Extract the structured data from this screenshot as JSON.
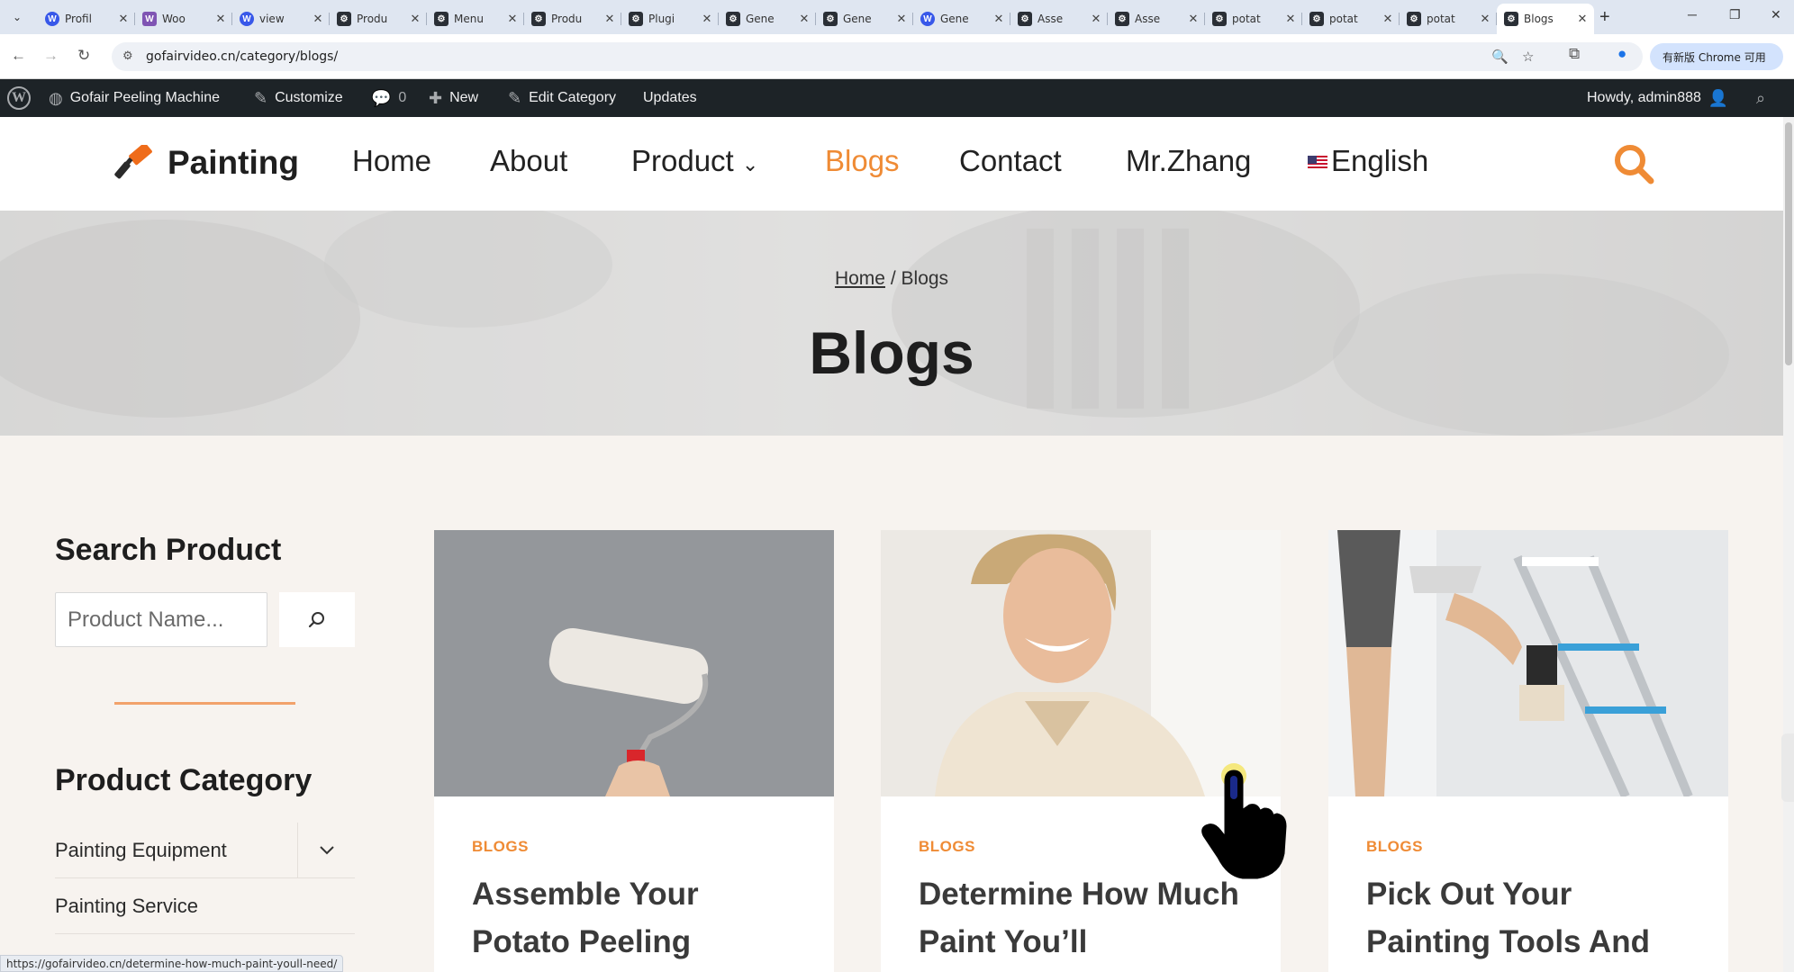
{
  "browser": {
    "tabs": [
      {
        "title": "Profil",
        "icon": "wordpress-icon"
      },
      {
        "title": "Woo",
        "icon": "woo-icon"
      },
      {
        "title": "view",
        "icon": "wordpress-icon"
      },
      {
        "title": "Produ",
        "icon": "gear-icon"
      },
      {
        "title": "Menu",
        "icon": "gear-icon"
      },
      {
        "title": "Produ",
        "icon": "gear-icon"
      },
      {
        "title": "Plugi",
        "icon": "gear-icon"
      },
      {
        "title": "Gene",
        "icon": "gear-icon"
      },
      {
        "title": "Gene",
        "icon": "gear-icon"
      },
      {
        "title": "Gene",
        "icon": "wordpress-icon"
      },
      {
        "title": "Asse",
        "icon": "gear-icon"
      },
      {
        "title": "Asse",
        "icon": "gear-icon"
      },
      {
        "title": "potat",
        "icon": "gear-icon"
      },
      {
        "title": "potat",
        "icon": "gear-icon"
      },
      {
        "title": "potat",
        "icon": "gear-icon"
      },
      {
        "title": "Blogs",
        "icon": "gear-icon",
        "active": true
      }
    ],
    "url": "gofairvideo.cn/category/blogs/",
    "chrome_badge": "有新版 Chrome 可用"
  },
  "adminbar": {
    "site_name": "Gofair Peeling Machine",
    "customize": "Customize",
    "comments_count": "0",
    "new": "New",
    "edit_category": "Edit Category",
    "updates": "Updates",
    "howdy": "Howdy, admin888"
  },
  "header": {
    "logo_text": "Painting",
    "nav": [
      {
        "label": "Home",
        "active": false
      },
      {
        "label": "About",
        "active": false
      },
      {
        "label": "Product",
        "active": false,
        "has_dropdown": true
      },
      {
        "label": "Blogs",
        "active": true
      },
      {
        "label": "Contact",
        "active": false
      },
      {
        "label": "Mr.Zhang",
        "active": false
      },
      {
        "label": "English",
        "active": false,
        "flag": "us-flag-icon"
      }
    ]
  },
  "hero": {
    "breadcrumb_home": "Home",
    "breadcrumb_sep": "/",
    "breadcrumb_current": "Blogs",
    "title": "Blogs"
  },
  "sidebar": {
    "search_heading": "Search Product",
    "search_placeholder": "Product Name...",
    "category_heading": "Product Category",
    "categories": [
      {
        "label": "Painting Equipment",
        "expandable": true
      },
      {
        "label": "Painting Service",
        "expandable": false
      }
    ]
  },
  "posts": [
    {
      "category": "BLOGS",
      "title": "Assemble Your Potato Peeling"
    },
    {
      "category": "BLOGS",
      "title": "Determine How Much Paint You’ll"
    },
    {
      "category": "BLOGS",
      "title": "Pick Out Your Painting Tools And"
    }
  ],
  "status_url": "https://gofairvideo.cn/determine-how-much-paint-youll-need/",
  "colors": {
    "accent": "#ef8b35",
    "admin_bar": "#1d2327",
    "page_bg": "#f7f3ef"
  }
}
